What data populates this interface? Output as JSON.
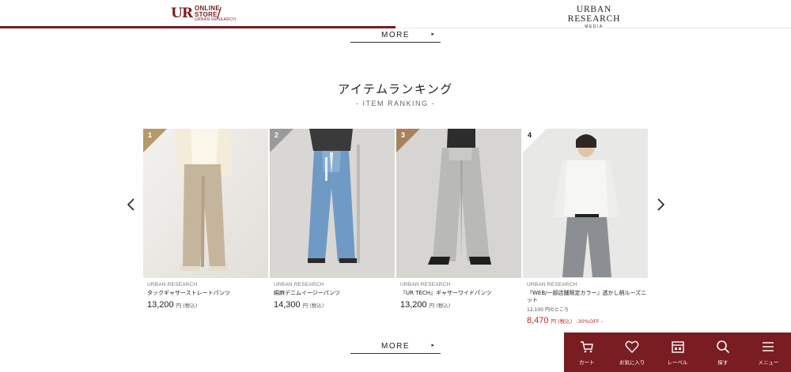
{
  "header": {
    "store_logo": {
      "mark": "UR",
      "line1": "ONLINE",
      "line2": "STORE",
      "sub": "URBAN RESEARCH"
    },
    "media_logo": {
      "main": "URBAN RESEARCH",
      "sub": "MEDIA"
    }
  },
  "top_more": {
    "label": "MORE",
    "arrow": "▸"
  },
  "ranking": {
    "title": "アイテムランキング",
    "subtitle": "- ITEM RANKING -",
    "items": [
      {
        "rank": "1",
        "rank_color": "#b49a6a",
        "brand": "URBAN RESEARCH",
        "name": "タックギャザーストレートパンツ",
        "price": "13,200",
        "tax": "円 (税込)"
      },
      {
        "rank": "2",
        "rank_color": "#9a9a9a",
        "brand": "URBAN RESEARCH",
        "name": "綿麻デニムイージーパンツ",
        "price": "14,300",
        "tax": "円 (税込)"
      },
      {
        "rank": "3",
        "rank_color": "#a8825c",
        "brand": "URBAN RESEARCH",
        "name": "『UR TECH』ギャザーワイドパンツ",
        "price": "13,200",
        "tax": "円 (税込)"
      },
      {
        "rank": "4",
        "rank_color": "#ffffff",
        "brand": "URBAN RESEARCH",
        "name": "『WEB/一部店舗限定カラー』透かし柄ルーズニット",
        "orig": "12,100 円のところ",
        "price": "8,470",
        "tax": "円 (税込)",
        "discount": "-30%OFF -"
      }
    ]
  },
  "bottom_more": {
    "label": "MORE",
    "arrow": "▸"
  },
  "bottom_nav": [
    {
      "label": "カート",
      "icon": "cart-icon"
    },
    {
      "label": "お気に入り",
      "icon": "heart-icon"
    },
    {
      "label": "レーベル",
      "icon": "label-store-icon"
    },
    {
      "label": "探す",
      "icon": "search-icon"
    },
    {
      "label": "メニュー",
      "icon": "menu-icon"
    }
  ],
  "colors": {
    "brand": "#7a1d22",
    "sale": "#c0262b"
  }
}
